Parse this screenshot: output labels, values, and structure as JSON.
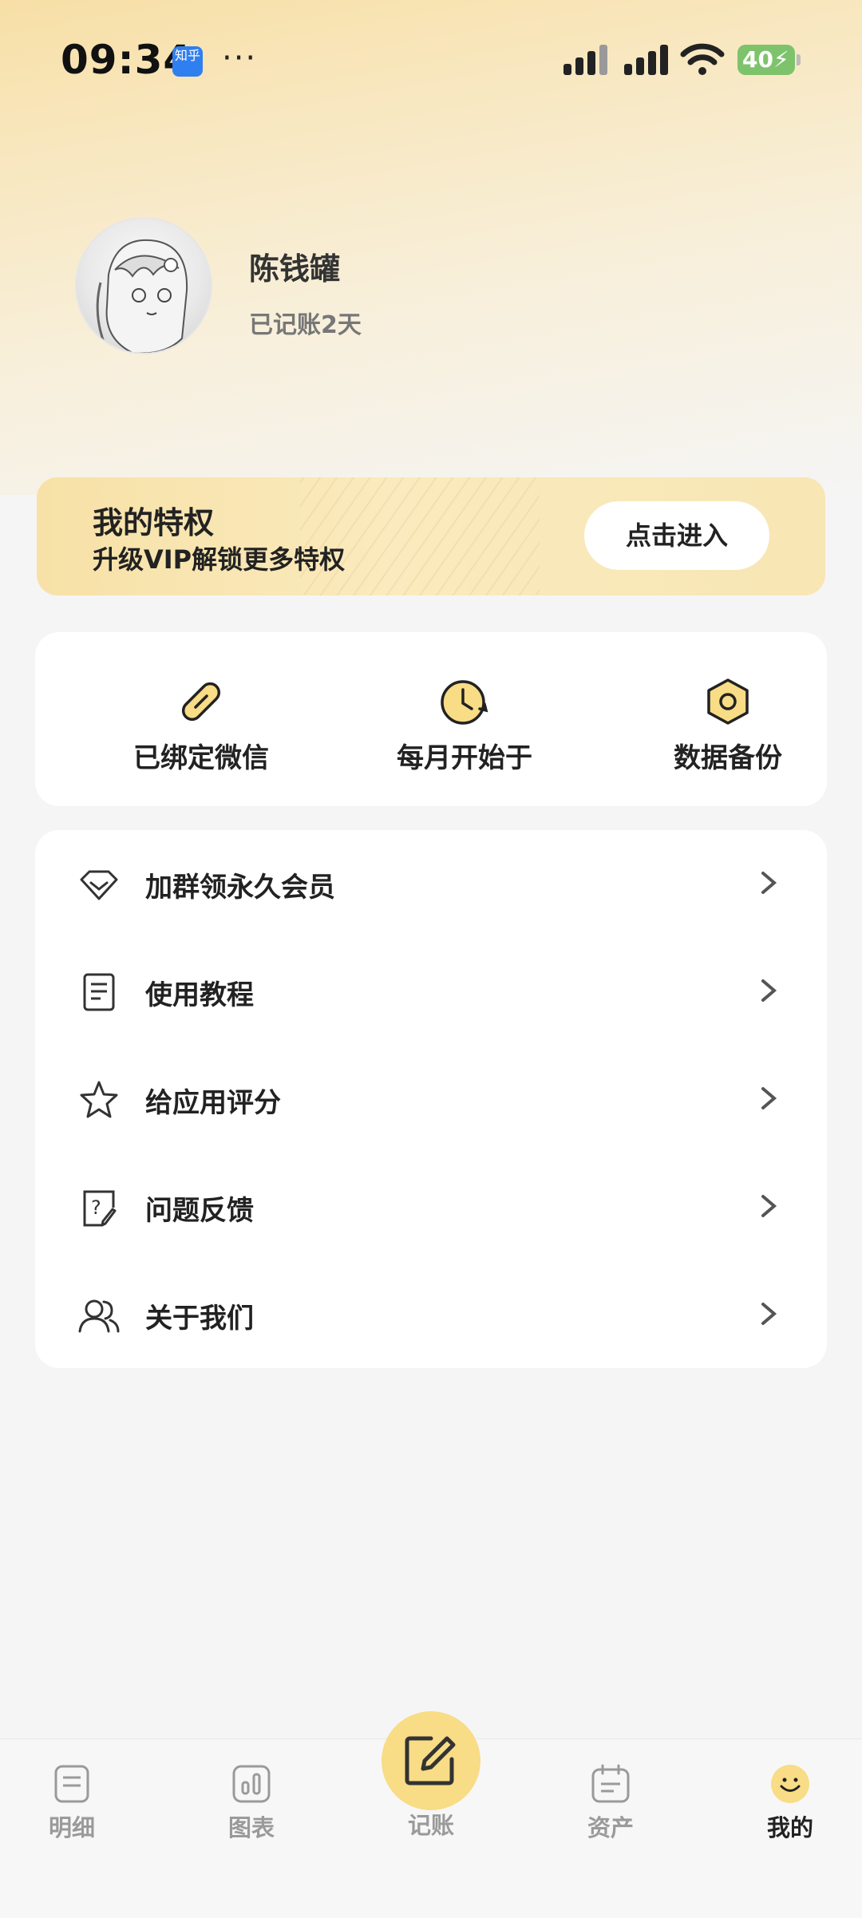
{
  "status_bar": {
    "time": "09:34",
    "app_badge": "知乎",
    "more": "···",
    "battery": "40"
  },
  "profile": {
    "name": "陈钱罐",
    "subtitle": "已记账2天"
  },
  "vip": {
    "title": "我的特权",
    "subtitle": "升级VIP解锁更多特权",
    "button": "点击进入"
  },
  "quick_actions": [
    {
      "label": "已绑定微信",
      "icon": "paperclip-icon"
    },
    {
      "label": "每月开始于",
      "icon": "clock-refresh-icon"
    },
    {
      "label": "数据备份",
      "icon": "hexagon-nut-icon"
    }
  ],
  "menu": [
    {
      "label": "加群领永久会员",
      "icon": "diamond-icon"
    },
    {
      "label": "使用教程",
      "icon": "document-icon"
    },
    {
      "label": "给应用评分",
      "icon": "star-icon"
    },
    {
      "label": "问题反馈",
      "icon": "question-note-icon"
    },
    {
      "label": "关于我们",
      "icon": "users-icon"
    }
  ],
  "tabs": [
    {
      "label": "明细",
      "icon": "list-icon"
    },
    {
      "label": "图表",
      "icon": "chart-icon"
    },
    {
      "label": "记账",
      "icon": "edit-icon"
    },
    {
      "label": "资产",
      "icon": "calendar-icon"
    },
    {
      "label": "我的",
      "icon": "smile-icon"
    }
  ],
  "colors": {
    "accent": "#f8dc86",
    "banner": "#f7e1a7",
    "active_tab": "#222222",
    "inactive_tab": "#9a9a9a"
  }
}
